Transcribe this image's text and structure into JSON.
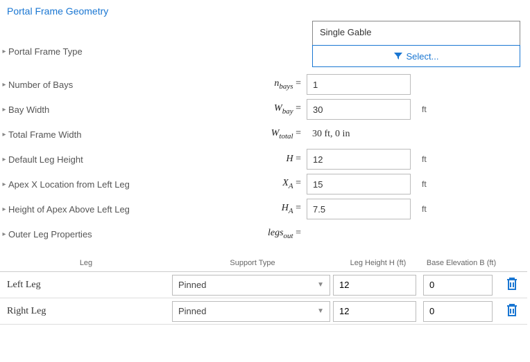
{
  "section_title": "Portal Frame Geometry",
  "frame_type": {
    "label": "Portal Frame Type",
    "value": "Single Gable",
    "select_label": "Select..."
  },
  "params": {
    "nbays": {
      "label": "Number of Bays",
      "sym_html": "<i>n</i><sub>bays</sub> =",
      "value": "1",
      "unit": ""
    },
    "wbay": {
      "label": "Bay Width",
      "sym_html": "<i>W</i><sub>bay</sub> =",
      "value": "30",
      "unit": "ft"
    },
    "wtotal": {
      "label": "Total Frame Width",
      "sym_html": "<i>W</i><sub>total</sub> =",
      "static": "30 ft, 0 in"
    },
    "h": {
      "label": "Default Leg Height",
      "sym_html": "<i>H</i> =",
      "value": "12",
      "unit": "ft"
    },
    "xa": {
      "label": "Apex X Location from Left Leg",
      "sym_html": "<i>X</i><sub>A</sub> =",
      "value": "15",
      "unit": "ft"
    },
    "ha": {
      "label": "Height of Apex Above Left Leg",
      "sym_html": "<i>H</i><sub>A</sub> =",
      "value": "7.5",
      "unit": "ft"
    },
    "legsout": {
      "label": "Outer Leg Properties",
      "sym_html": "<i>legs</i><sub>out</sub> ="
    }
  },
  "table": {
    "headers": {
      "leg": "Leg",
      "support": "Support Type",
      "h": "Leg Height H (ft)",
      "b": "Base Elevation B (ft)"
    },
    "rows": [
      {
        "leg": "Left Leg",
        "support": "Pinned",
        "h": "12",
        "b": "0"
      },
      {
        "leg": "Right Leg",
        "support": "Pinned",
        "h": "12",
        "b": "0"
      }
    ]
  }
}
